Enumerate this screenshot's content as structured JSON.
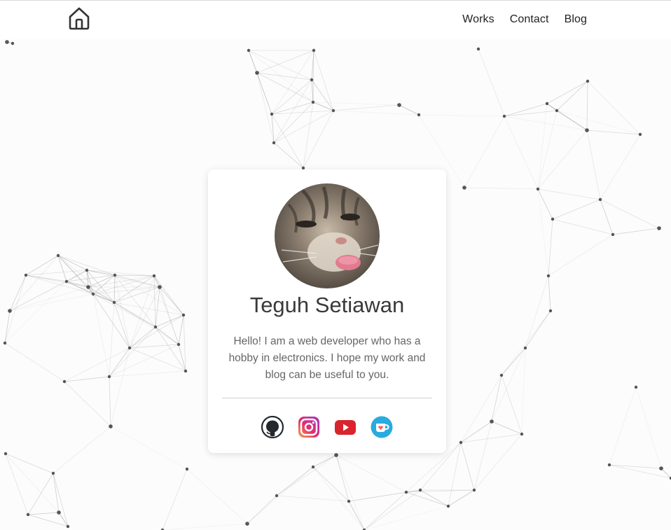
{
  "nav": {
    "home_icon": "home-icon",
    "links": [
      {
        "label": "Works"
      },
      {
        "label": "Contact"
      },
      {
        "label": "Blog"
      }
    ]
  },
  "profile": {
    "name": "Teguh Setiawan",
    "bio": "Hello! I am a web developer who has a hobby in electronics. I hope my work and blog can be useful to you.",
    "avatar_icon": "cat-avatar-image"
  },
  "socials": [
    {
      "icon": "github-icon",
      "color": "#24292e"
    },
    {
      "icon": "instagram-icon",
      "color": "#e1306c"
    },
    {
      "icon": "youtube-icon",
      "color": "#d9232d"
    },
    {
      "icon": "kofi-icon",
      "color": "#29abe0"
    }
  ],
  "colors": {
    "background": "#fcfcfc",
    "network_line": "#9a9a9a",
    "network_node": "#555555"
  }
}
